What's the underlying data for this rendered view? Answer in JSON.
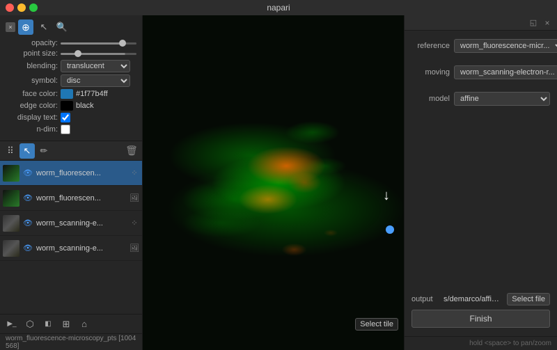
{
  "app": {
    "title": "napari"
  },
  "titlebar": {
    "title": "napari"
  },
  "properties": {
    "close_label": "×",
    "opacity_label": "opacity:",
    "point_size_label": "point size:",
    "blending_label": "blending:",
    "symbol_label": "symbol:",
    "face_color_label": "face color:",
    "edge_color_label": "edge color:",
    "display_text_label": "display text:",
    "n_dim_label": "n-dim:",
    "blending_value": "translucent",
    "symbol_value": "disc",
    "face_color_hex": "#1f77b4ff",
    "face_color_value": "#1f77b4ff",
    "edge_color_value": "black"
  },
  "layers_toolbar": {
    "dots_icon": "⠿",
    "arrow_icon": "↖",
    "pencil_icon": "✏",
    "delete_icon": "🗑"
  },
  "layers": [
    {
      "name": "worm_fluorescen...",
      "type": "pts",
      "thumb_class": "layer-thumb-fluorescent",
      "selected": true,
      "eye_visible": true
    },
    {
      "name": "worm_fluorescen...",
      "type": "img",
      "thumb_class": "layer-thumb-fluorescent",
      "selected": false,
      "eye_visible": true
    },
    {
      "name": "worm_scanning-e...",
      "type": "pts",
      "thumb_class": "layer-thumb-scanning",
      "selected": false,
      "eye_visible": true
    },
    {
      "name": "worm_scanning-e...",
      "type": "img",
      "thumb_class": "layer-thumb-scanning",
      "selected": false,
      "eye_visible": true
    }
  ],
  "bottom_toolbar": {
    "console_icon": ">_",
    "bug_icon": "⬡",
    "grid_icon": "⊞",
    "home_icon": "⌂"
  },
  "status": {
    "text": "worm_fluorescence-microscopy_pts [1004  568]"
  },
  "right_panel": {
    "reference_label": "reference",
    "reference_value": "worm_fluorescence-micr...",
    "moving_label": "moving",
    "moving_value": "worm_scanning-electron-r...",
    "model_label": "model",
    "model_value": "affine",
    "output_label": "output",
    "output_path": "s/demarco/affine.txt",
    "select_file_label": "Select file",
    "finish_label": "Finish",
    "hint": "hold <space> to pan/zoom",
    "close_icon": "×",
    "float_icon": "◱"
  },
  "canvas": {
    "select_tile_label": "Select tile"
  }
}
